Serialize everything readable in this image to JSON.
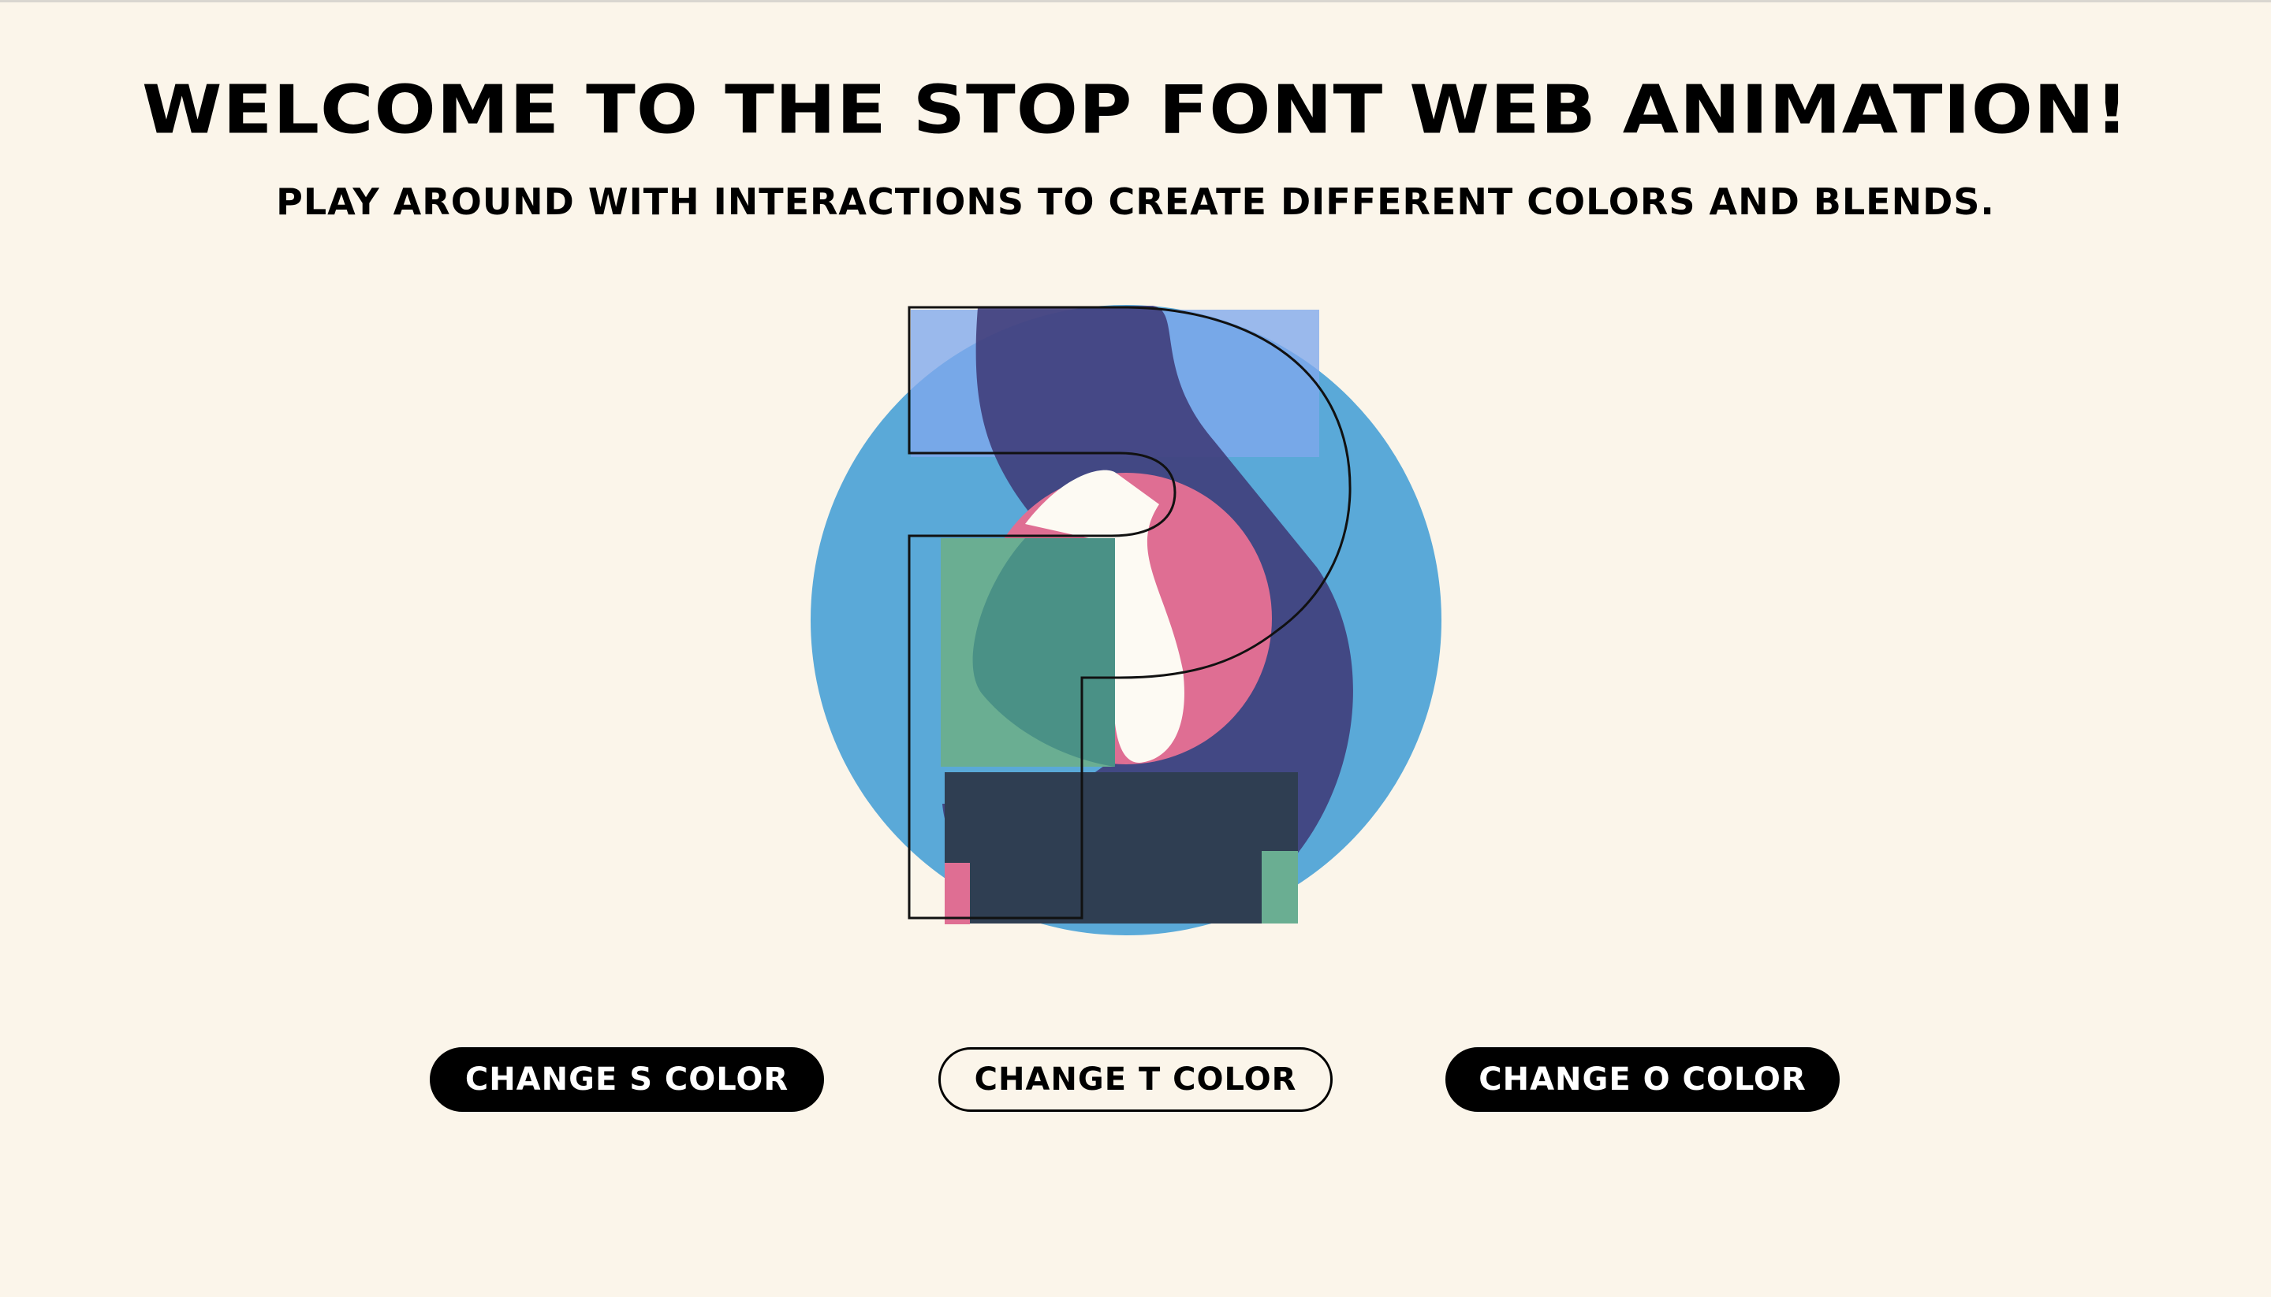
{
  "header": {
    "title": "Welcome to the Stop Font Web Animation!",
    "subtitle": "Play around with interactions to create different colors and blends."
  },
  "artwork": {
    "letters": [
      "S",
      "T",
      "O"
    ],
    "colors": {
      "circle_o": "#5aa9d8",
      "letter_s": "#3f3a78",
      "square_top": "#8fb0ef",
      "bar_bottom": "#2f3e52",
      "green_block": "#6aae92",
      "pink_circle": "#df6e93"
    }
  },
  "controls": {
    "change_s": "Change S Color",
    "change_t": "Change T Color",
    "change_o": "Change O Color"
  }
}
